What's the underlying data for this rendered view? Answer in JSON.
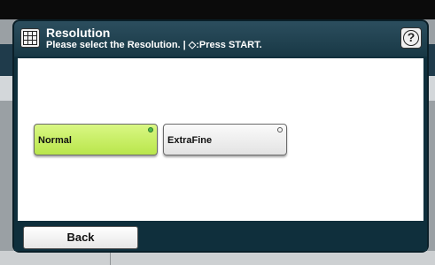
{
  "dialog": {
    "title": "Resolution",
    "subtitle": "Please select the Resolution. | ◇:Press START.",
    "icon": "grid-icon",
    "help_label": "?"
  },
  "options": [
    {
      "label": "Normal",
      "selected": true
    },
    {
      "label": "ExtraFine",
      "selected": false
    }
  ],
  "footer": {
    "back_label": "Back"
  },
  "colors": {
    "header": "#183845",
    "selected": "#c5ee62",
    "unselected": "#eeeeee"
  }
}
